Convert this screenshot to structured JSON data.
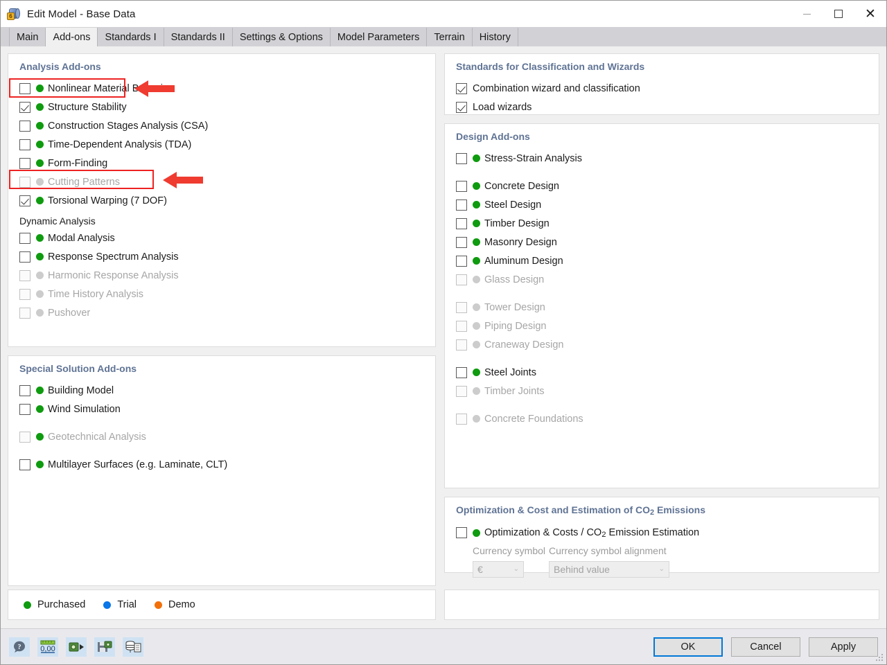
{
  "window": {
    "title": "Edit Model - Base Data",
    "icon": "model-cube-icon",
    "minimize_label": "—",
    "maximize_label": "☐",
    "close_label": "✕"
  },
  "tabs": [
    {
      "label": "Main",
      "active": false
    },
    {
      "label": "Add-ons",
      "active": true
    },
    {
      "label": "Standards I",
      "active": false
    },
    {
      "label": "Standards II",
      "active": false
    },
    {
      "label": "Settings & Options",
      "active": false
    },
    {
      "label": "Model Parameters",
      "active": false
    },
    {
      "label": "Terrain",
      "active": false
    },
    {
      "label": "History",
      "active": false
    }
  ],
  "analysis_addons": {
    "title": "Analysis Add-ons",
    "items": [
      {
        "label": "Nonlinear Material Behavior",
        "checked": false,
        "enabled": true,
        "status": "green",
        "highlight": false
      },
      {
        "label": "Structure Stability",
        "checked": true,
        "enabled": true,
        "status": "green",
        "highlight": true
      },
      {
        "label": "Construction Stages Analysis (CSA)",
        "checked": false,
        "enabled": true,
        "status": "green",
        "highlight": false
      },
      {
        "label": "Time-Dependent Analysis (TDA)",
        "checked": false,
        "enabled": true,
        "status": "green",
        "highlight": false
      },
      {
        "label": "Form-Finding",
        "checked": false,
        "enabled": true,
        "status": "green",
        "highlight": false
      },
      {
        "label": "Cutting Patterns",
        "checked": false,
        "enabled": false,
        "status": "grey",
        "highlight": false
      },
      {
        "label": "Torsional Warping (7 DOF)",
        "checked": true,
        "enabled": true,
        "status": "green",
        "highlight": true
      }
    ],
    "dynamic_subtitle": "Dynamic Analysis",
    "dynamic_items": [
      {
        "label": "Modal Analysis",
        "checked": false,
        "enabled": true,
        "status": "green"
      },
      {
        "label": "Response Spectrum Analysis",
        "checked": false,
        "enabled": true,
        "status": "green"
      },
      {
        "label": "Harmonic Response Analysis",
        "checked": false,
        "enabled": false,
        "status": "grey"
      },
      {
        "label": "Time History Analysis",
        "checked": false,
        "enabled": false,
        "status": "grey"
      },
      {
        "label": "Pushover",
        "checked": false,
        "enabled": false,
        "status": "grey"
      }
    ]
  },
  "special_addons": {
    "title": "Special Solution Add-ons",
    "items": [
      {
        "label": "Building Model",
        "checked": false,
        "enabled": true,
        "status": "green",
        "gap_before": false
      },
      {
        "label": "Wind Simulation",
        "checked": false,
        "enabled": true,
        "status": "green",
        "gap_before": false
      },
      {
        "label": "Geotechnical Analysis",
        "checked": false,
        "enabled": false,
        "status": "green",
        "gap_before": true
      },
      {
        "label": "Multilayer Surfaces (e.g. Laminate, CLT)",
        "checked": false,
        "enabled": true,
        "status": "green",
        "gap_before": true
      }
    ]
  },
  "standards_wizards": {
    "title": "Standards for Classification and Wizards",
    "items": [
      {
        "label": "Combination wizard and classification",
        "checked": true,
        "enabled": true,
        "status": "none"
      },
      {
        "label": "Load wizards",
        "checked": true,
        "enabled": true,
        "status": "none"
      }
    ]
  },
  "design_addons": {
    "title": "Design Add-ons",
    "items": [
      {
        "label": "Stress-Strain Analysis",
        "checked": false,
        "enabled": true,
        "status": "green",
        "gap_before": false
      },
      {
        "label": "Concrete Design",
        "checked": false,
        "enabled": true,
        "status": "green",
        "gap_before": true
      },
      {
        "label": "Steel Design",
        "checked": false,
        "enabled": true,
        "status": "green",
        "gap_before": false
      },
      {
        "label": "Timber Design",
        "checked": false,
        "enabled": true,
        "status": "green",
        "gap_before": false
      },
      {
        "label": "Masonry Design",
        "checked": false,
        "enabled": true,
        "status": "green",
        "gap_before": false
      },
      {
        "label": "Aluminum Design",
        "checked": false,
        "enabled": true,
        "status": "green",
        "gap_before": false
      },
      {
        "label": "Glass Design",
        "checked": false,
        "enabled": false,
        "status": "grey",
        "gap_before": false
      },
      {
        "label": "Tower Design",
        "checked": false,
        "enabled": false,
        "status": "grey",
        "gap_before": true
      },
      {
        "label": "Piping Design",
        "checked": false,
        "enabled": false,
        "status": "grey",
        "gap_before": false
      },
      {
        "label": "Craneway Design",
        "checked": false,
        "enabled": false,
        "status": "grey",
        "gap_before": false
      },
      {
        "label": "Steel Joints",
        "checked": false,
        "enabled": true,
        "status": "green",
        "gap_before": true
      },
      {
        "label": "Timber Joints",
        "checked": false,
        "enabled": false,
        "status": "grey",
        "gap_before": false
      },
      {
        "label": "Concrete Foundations",
        "checked": false,
        "enabled": false,
        "status": "grey",
        "gap_before": true
      }
    ]
  },
  "optimization": {
    "title_part1": "Optimization & Cost and Estimation of CO",
    "title_sub": "2",
    "title_part2": " Emissions",
    "item_part1": "Optimization & Costs / CO",
    "item_sub": "2",
    "item_part2": " Emission Estimation",
    "item_checked": false,
    "item_status": "green",
    "currency_symbol_label": "Currency symbol",
    "currency_symbol_value": "€",
    "currency_alignment_label": "Currency symbol alignment",
    "currency_alignment_value": "Behind value",
    "chevron": "⌄"
  },
  "legend": {
    "items": [
      {
        "label": "Purchased",
        "color": "green"
      },
      {
        "label": "Trial",
        "color": "blue"
      },
      {
        "label": "Demo",
        "color": "orange"
      }
    ]
  },
  "footer": {
    "tools": [
      {
        "name": "help-icon"
      },
      {
        "name": "units-icon",
        "text": "0,00"
      },
      {
        "name": "import-icon"
      },
      {
        "name": "save-defaults-icon"
      },
      {
        "name": "database-icon"
      }
    ],
    "buttons": [
      {
        "label": "OK",
        "primary": true
      },
      {
        "label": "Cancel",
        "primary": false
      },
      {
        "label": "Apply",
        "primary": false
      }
    ]
  },
  "annotations": {
    "arrow_color": "#ef3b30",
    "box_color": "#ee2222",
    "arrows": [
      {
        "target": "Structure Stability"
      },
      {
        "target": "Torsional Warping (7 DOF)"
      }
    ]
  }
}
